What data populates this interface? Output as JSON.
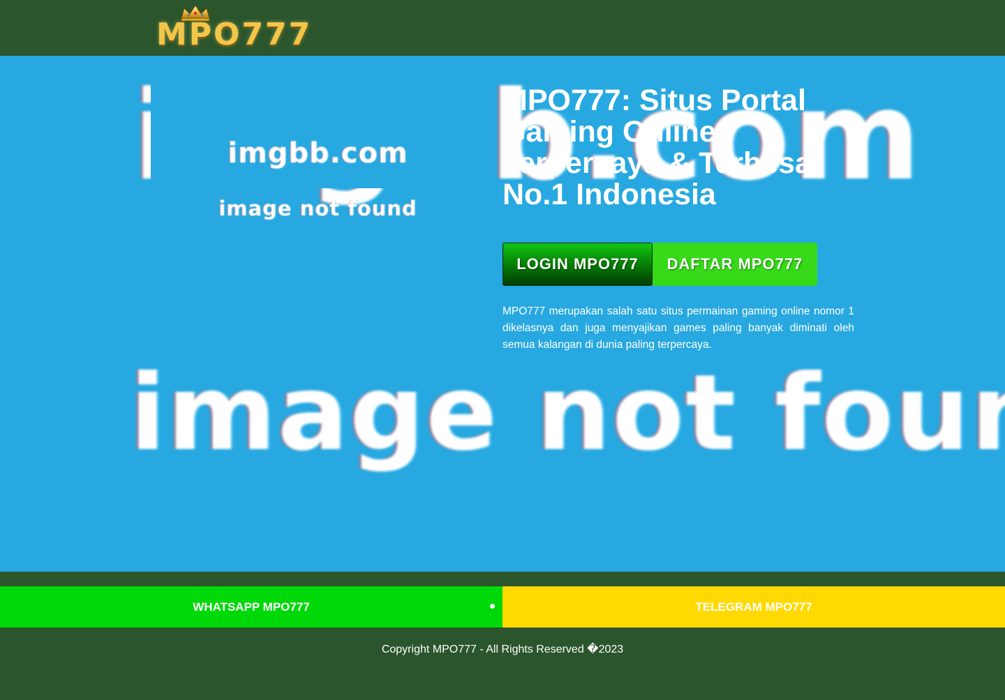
{
  "header": {
    "logo_text": "MPO777"
  },
  "hero": {
    "bg_text_top": "imgbb.com",
    "bg_text_bottom": "image not found",
    "image_label_1": "imgbb.com",
    "image_label_2": "image not found",
    "title": "MPO777: Situs Portal Gaming Online Terpercaya & Terbesar No.1 Indonesia",
    "login_label": "LOGIN MPO777",
    "daftar_label": "DAFTAR MPO777",
    "description": "MPO777 merupakan salah satu situs permainan gaming online nomor 1 dikelasnya dan juga menyajikan games paling banyak diminati oleh semua kalangan di dunia paling terpercaya."
  },
  "bottom_bar": {
    "whatsapp_label": "WHATSAPP MPO777",
    "telegram_label": "TELEGRAM MPO777"
  },
  "footer": {
    "copyright": "Copyright MPO777 - All Rights Reserved �2023"
  },
  "colors": {
    "header_bg": "#2b552c",
    "hero_bg": "#27a8e0",
    "login_btn": "#078607",
    "daftar_btn": "#36da18",
    "whatsapp_bar": "#00d909",
    "telegram_bar": "#ffd900"
  }
}
